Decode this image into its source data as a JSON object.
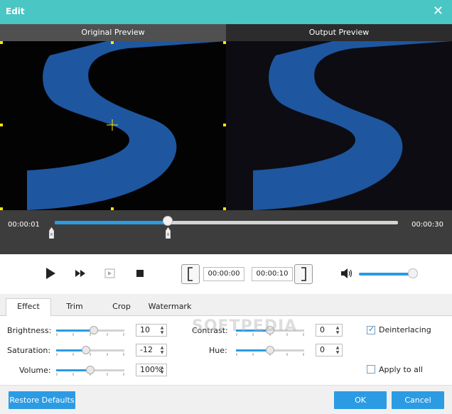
{
  "window": {
    "title": "Edit"
  },
  "preview": {
    "original_label": "Original Preview",
    "output_label": "Output Preview"
  },
  "timeline": {
    "start_time": "00:00:01",
    "end_time": "00:00:30",
    "progress": 0.33
  },
  "player": {
    "start_field": "00:00:00",
    "end_field": "00:00:10",
    "volume": 1.0
  },
  "tabs": [
    {
      "label": "Effect",
      "active": true
    },
    {
      "label": "Trim",
      "active": false
    },
    {
      "label": "Crop",
      "active": false
    },
    {
      "label": "Watermark",
      "active": false
    }
  ],
  "effect": {
    "brightness": {
      "label": "Brightness:",
      "value": "10",
      "level": 0.55
    },
    "saturation": {
      "label": "Saturation:",
      "value": "-12",
      "level": 0.44
    },
    "volume": {
      "label": "Volume:",
      "value": "100%",
      "level": 0.5
    },
    "contrast": {
      "label": "Contrast:",
      "value": "0",
      "level": 0.5
    },
    "hue": {
      "label": "Hue:",
      "value": "0",
      "level": 0.5
    },
    "deinterlacing": {
      "label": "Deinterlacing",
      "checked": true
    },
    "apply_to_all": {
      "label": "Apply to all",
      "checked": false
    }
  },
  "footer": {
    "restore_label": "Restore Defaults",
    "ok_label": "OK",
    "cancel_label": "Cancel"
  },
  "watermark_text": "SOFTPEDIA",
  "colors": {
    "accent": "#2b9be4",
    "titlebar": "#4ac6c4",
    "logo_blue": "#1e56a0"
  }
}
